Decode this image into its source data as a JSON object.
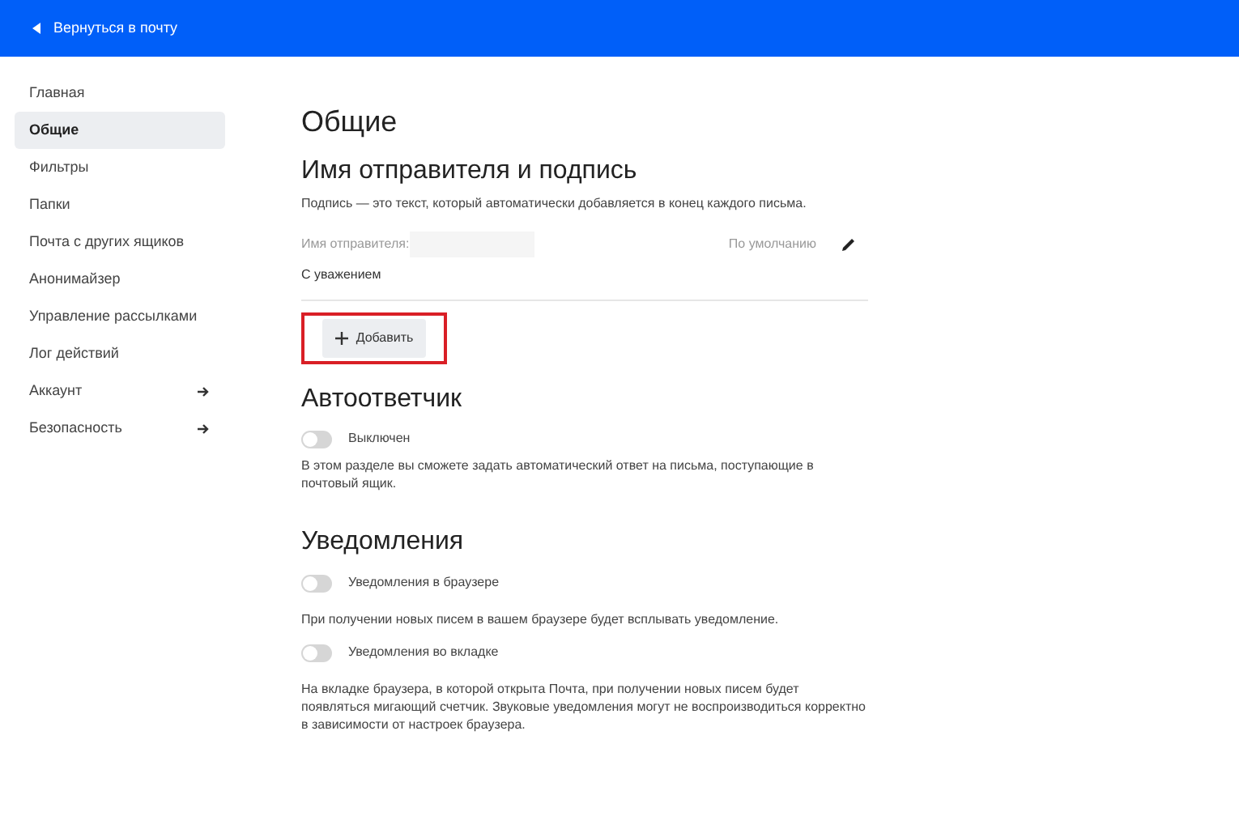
{
  "top_bar": {
    "back_link": "Вернуться в почту"
  },
  "sidebar": {
    "items": [
      {
        "label": "Главная",
        "selected": false,
        "has_arrow": false
      },
      {
        "label": "Общие",
        "selected": true,
        "has_arrow": false
      },
      {
        "label": "Фильтры",
        "selected": false,
        "has_arrow": false
      },
      {
        "label": "Папки",
        "selected": false,
        "has_arrow": false
      },
      {
        "label": "Почта с других ящиков",
        "selected": false,
        "has_arrow": false
      },
      {
        "label": "Анонимайзер",
        "selected": false,
        "has_arrow": false
      },
      {
        "label": "Управление рассылками",
        "selected": false,
        "has_arrow": false
      },
      {
        "label": "Лог действий",
        "selected": false,
        "has_arrow": false
      },
      {
        "label": "Аккаунт",
        "selected": false,
        "has_arrow": true
      },
      {
        "label": "Безопасность",
        "selected": false,
        "has_arrow": true
      }
    ]
  },
  "page_title": "Общие",
  "signature": {
    "heading": "Имя отправителя и подпись",
    "description": "Подпись — это текст, который автоматически добавляется в конец каждого письма.",
    "sender_label": "Имя отправителя:",
    "default_label": "По умолчанию",
    "signature_text": "С уважением",
    "add_button": {
      "label": "Добавить",
      "highlighted": true
    }
  },
  "autoresponder": {
    "heading": "Автоответчик",
    "toggle": {
      "label": "Выключен",
      "on": false
    },
    "description": "В этом разделе вы сможете задать автоматический ответ на письма, поступающие в почтовый ящик."
  },
  "notifications": {
    "heading": "Уведомления",
    "items": [
      {
        "label": "Уведомления в браузере",
        "on": false,
        "description": "При получении новых писем в вашем браузере будет всплывать уведомление."
      },
      {
        "label": "Уведомления во вкладке",
        "on": false,
        "description": "На вкладке браузера, в которой открыта Почта, при получении новых писем будет появляться мигающий счетчик. Звуковые уведомления могут не воспроизводиться корректно в зависимости от настроек браузера."
      }
    ]
  }
}
